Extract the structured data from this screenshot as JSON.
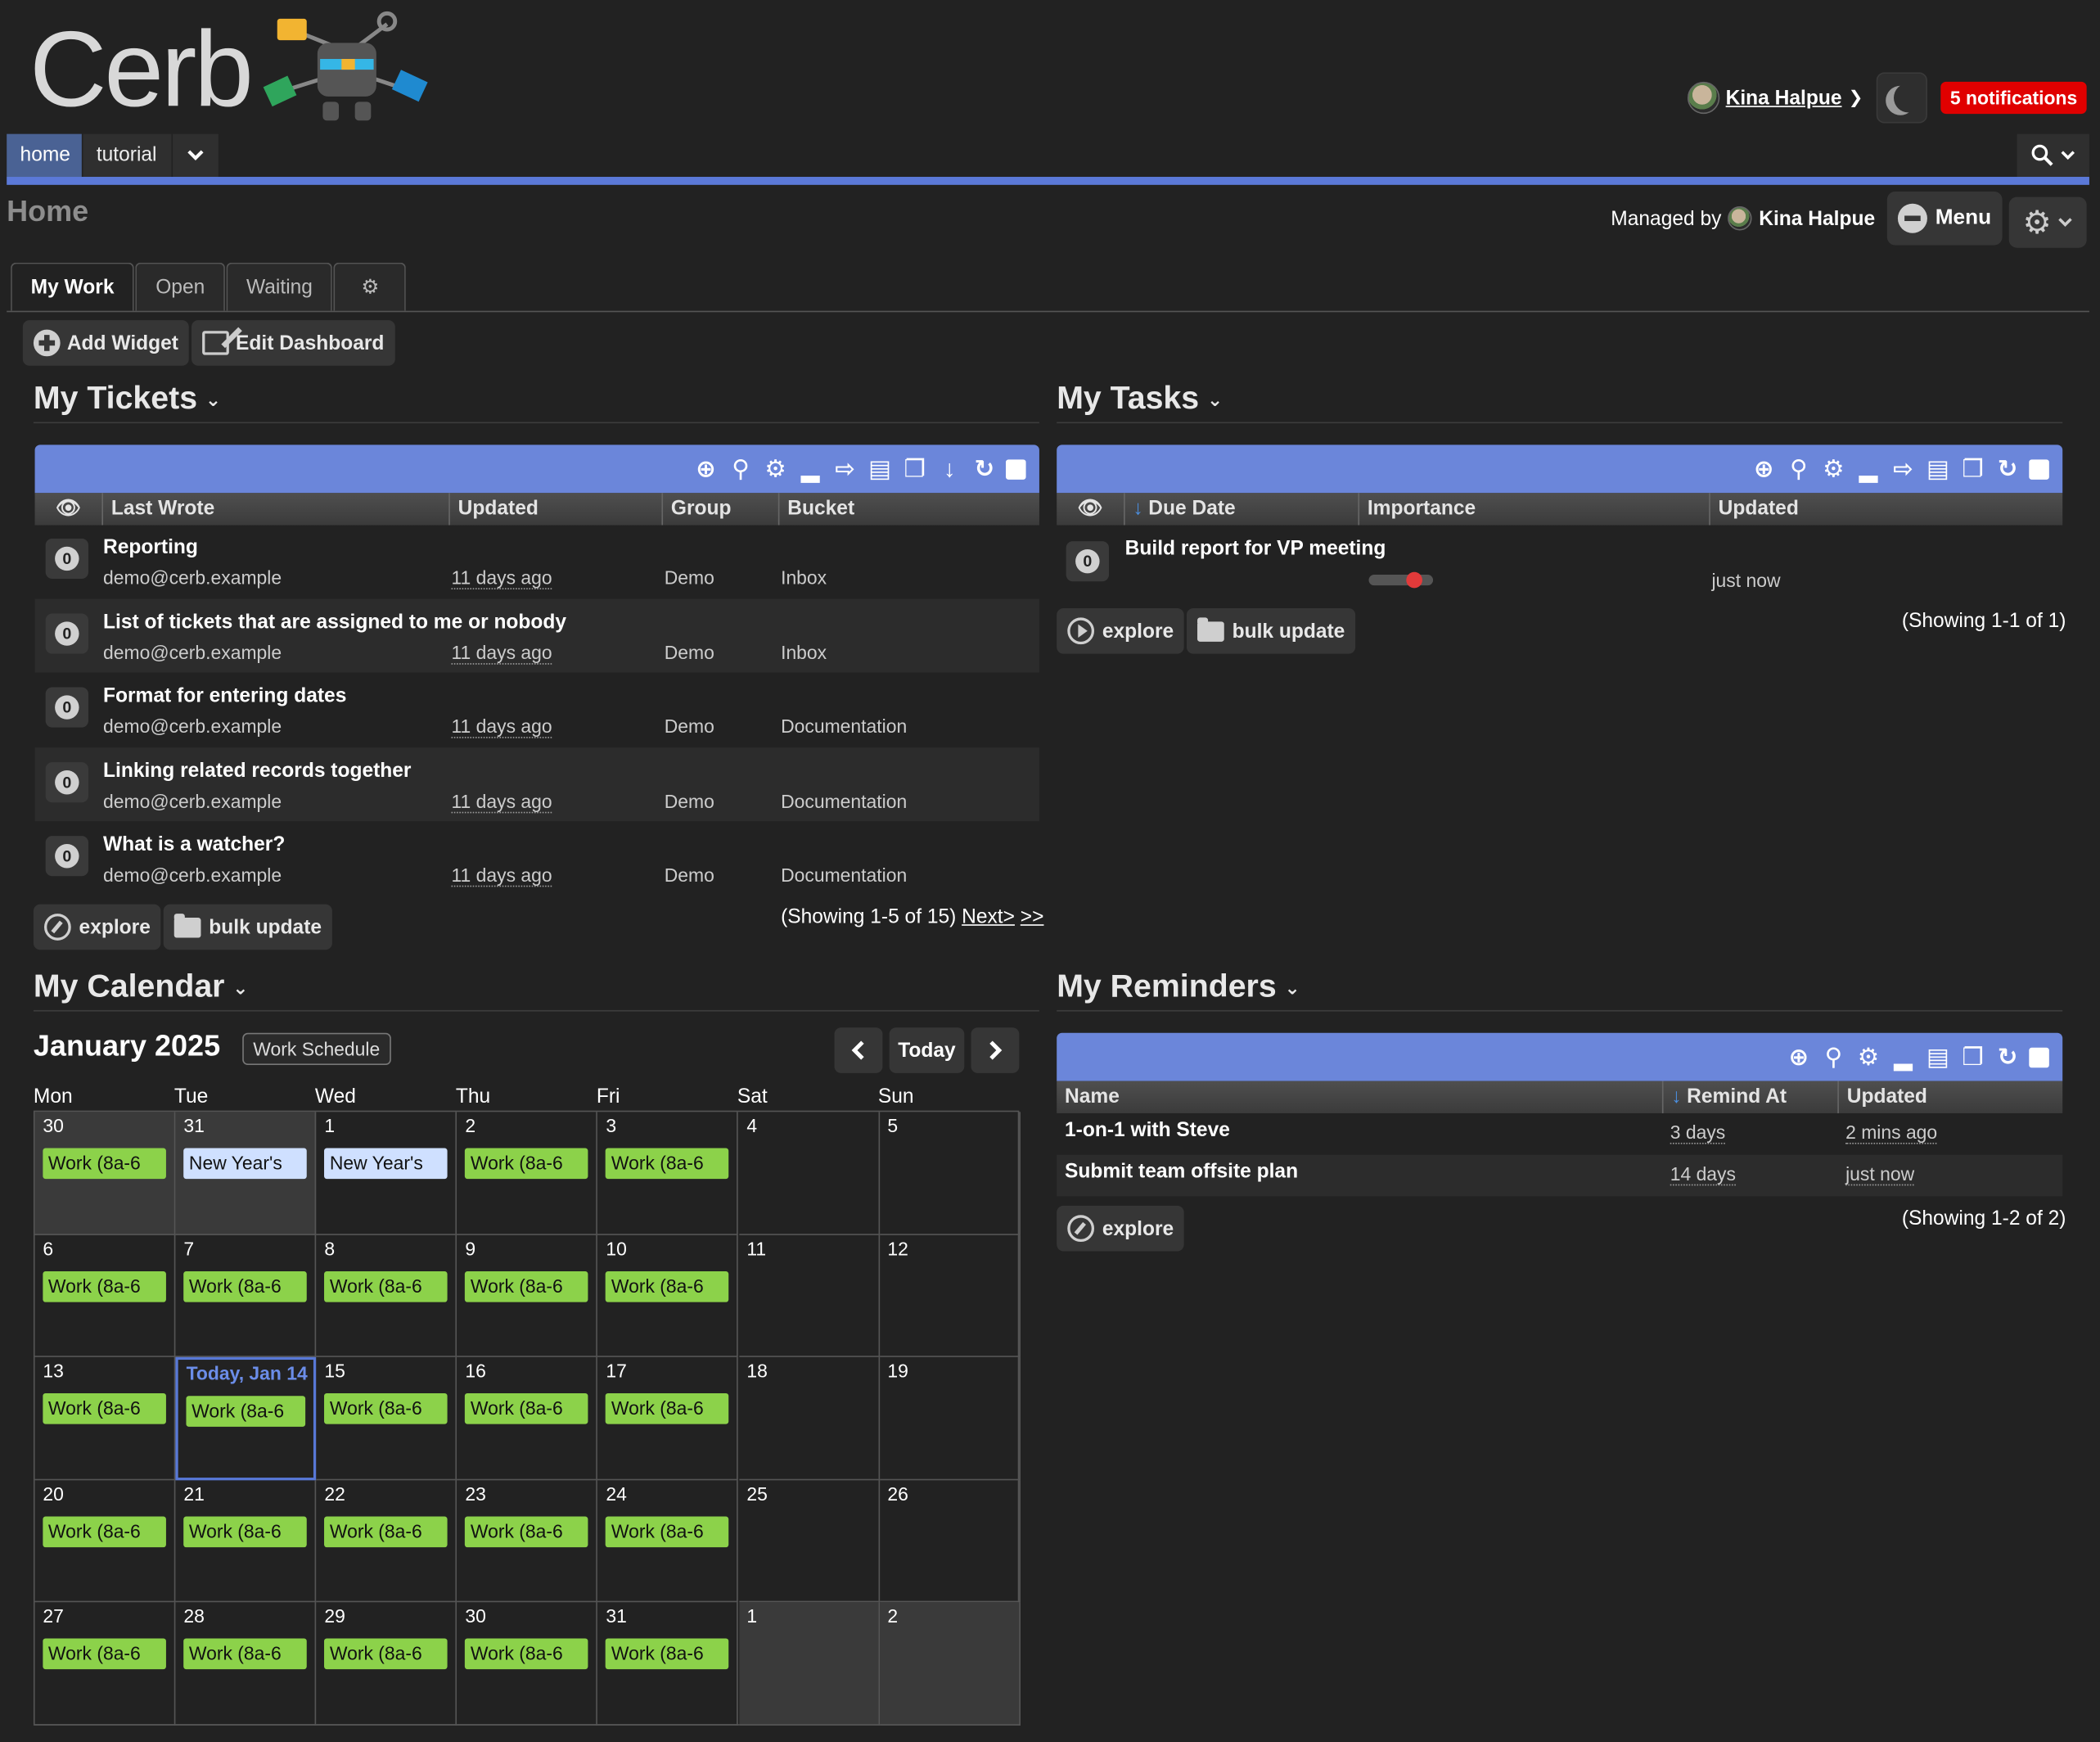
{
  "app": {
    "logo_text": "Cerb"
  },
  "user": {
    "name": "Kina Halpue",
    "notifications": "5 notifications"
  },
  "nav": {
    "tabs": [
      "home",
      "tutorial"
    ]
  },
  "page": {
    "title": "Home",
    "managed_by_label": "Managed by",
    "managed_by": "Kina Halpue",
    "menu_label": "Menu"
  },
  "dashboard": {
    "tabs": [
      "My Work",
      "Open",
      "Waiting"
    ],
    "add_widget": "Add Widget",
    "edit_dashboard": "Edit Dashboard"
  },
  "colors": {
    "accent": "#6b86da",
    "nav_blue": "#5b79d8",
    "work_event": "#8cd24a",
    "holiday_event": "#cfe0ff",
    "notif_red": "#e00000"
  },
  "tickets": {
    "title": "My Tickets",
    "columns": [
      "Last Wrote",
      "Updated",
      "Group",
      "Bucket"
    ],
    "rows": [
      {
        "title": "Reporting",
        "watchers": "0",
        "last_wrote": "demo@cerb.example",
        "updated": "11 days ago",
        "group": "Demo",
        "bucket": "Inbox"
      },
      {
        "title": "List of tickets that are assigned to me or nobody",
        "watchers": "0",
        "last_wrote": "demo@cerb.example",
        "updated": "11 days ago",
        "group": "Demo",
        "bucket": "Inbox"
      },
      {
        "title": "Format for entering dates",
        "watchers": "0",
        "last_wrote": "demo@cerb.example",
        "updated": "11 days ago",
        "group": "Demo",
        "bucket": "Documentation"
      },
      {
        "title": "Linking related records together",
        "watchers": "0",
        "last_wrote": "demo@cerb.example",
        "updated": "11 days ago",
        "group": "Demo",
        "bucket": "Documentation"
      },
      {
        "title": "What is a watcher?",
        "watchers": "0",
        "last_wrote": "demo@cerb.example",
        "updated": "11 days ago",
        "group": "Demo",
        "bucket": "Documentation"
      }
    ],
    "explore": "explore",
    "bulk_update": "bulk update",
    "showing": "(Showing 1-5 of 15)",
    "next": "Next>",
    "last": ">>"
  },
  "tasks": {
    "title": "My Tasks",
    "columns": [
      "Due Date",
      "Importance",
      "Updated"
    ],
    "rows": [
      {
        "title": "Build report for VP meeting",
        "watchers": "0",
        "importance": 0.7,
        "updated": "just now"
      }
    ],
    "explore": "explore",
    "bulk_update": "bulk update",
    "showing": "(Showing 1-1 of 1)"
  },
  "reminders": {
    "title": "My Reminders",
    "columns": [
      "Name",
      "Remind At",
      "Updated"
    ],
    "rows": [
      {
        "name": "1-on-1 with Steve",
        "remind_at": "3 days",
        "updated": "2 mins ago"
      },
      {
        "name": "Submit team offsite plan",
        "remind_at": "14 days",
        "updated": "just now"
      }
    ],
    "explore": "explore",
    "showing": "(Showing 1-2 of 2)"
  },
  "calendar": {
    "title": "My Calendar",
    "month": "January 2025",
    "schedule": "Work Schedule",
    "today_btn": "Today",
    "weekdays": [
      "Mon",
      "Tue",
      "Wed",
      "Thu",
      "Fri",
      "Sat",
      "Sun"
    ],
    "weeks": [
      [
        {
          "n": "30",
          "other": true,
          "ev": "Work (8a-6",
          "t": "work"
        },
        {
          "n": "31",
          "other": true,
          "ev": "New Year's",
          "t": "holiday"
        },
        {
          "n": "1",
          "ev": "New Year's",
          "t": "holiday"
        },
        {
          "n": "2",
          "ev": "Work (8a-6",
          "t": "work"
        },
        {
          "n": "3",
          "ev": "Work (8a-6",
          "t": "work"
        },
        {
          "n": "4"
        },
        {
          "n": "5"
        }
      ],
      [
        {
          "n": "6",
          "ev": "Work (8a-6",
          "t": "work"
        },
        {
          "n": "7",
          "ev": "Work (8a-6",
          "t": "work"
        },
        {
          "n": "8",
          "ev": "Work (8a-6",
          "t": "work"
        },
        {
          "n": "9",
          "ev": "Work (8a-6",
          "t": "work"
        },
        {
          "n": "10",
          "ev": "Work (8a-6",
          "t": "work"
        },
        {
          "n": "11"
        },
        {
          "n": "12"
        }
      ],
      [
        {
          "n": "13",
          "ev": "Work (8a-6",
          "t": "work"
        },
        {
          "n": "Today, Jan 14",
          "today": true,
          "ev": "Work (8a-6",
          "t": "work"
        },
        {
          "n": "15",
          "ev": "Work (8a-6",
          "t": "work"
        },
        {
          "n": "16",
          "ev": "Work (8a-6",
          "t": "work"
        },
        {
          "n": "17",
          "ev": "Work (8a-6",
          "t": "work"
        },
        {
          "n": "18"
        },
        {
          "n": "19"
        }
      ],
      [
        {
          "n": "20",
          "ev": "Work (8a-6",
          "t": "work"
        },
        {
          "n": "21",
          "ev": "Work (8a-6",
          "t": "work"
        },
        {
          "n": "22",
          "ev": "Work (8a-6",
          "t": "work"
        },
        {
          "n": "23",
          "ev": "Work (8a-6",
          "t": "work"
        },
        {
          "n": "24",
          "ev": "Work (8a-6",
          "t": "work"
        },
        {
          "n": "25"
        },
        {
          "n": "26"
        }
      ],
      [
        {
          "n": "27",
          "ev": "Work (8a-6",
          "t": "work"
        },
        {
          "n": "28",
          "ev": "Work (8a-6",
          "t": "work"
        },
        {
          "n": "29",
          "ev": "Work (8a-6",
          "t": "work"
        },
        {
          "n": "30",
          "ev": "Work (8a-6",
          "t": "work"
        },
        {
          "n": "31",
          "ev": "Work (8a-6",
          "t": "work"
        },
        {
          "n": "1",
          "other": true
        },
        {
          "n": "2",
          "other": true
        }
      ]
    ]
  }
}
